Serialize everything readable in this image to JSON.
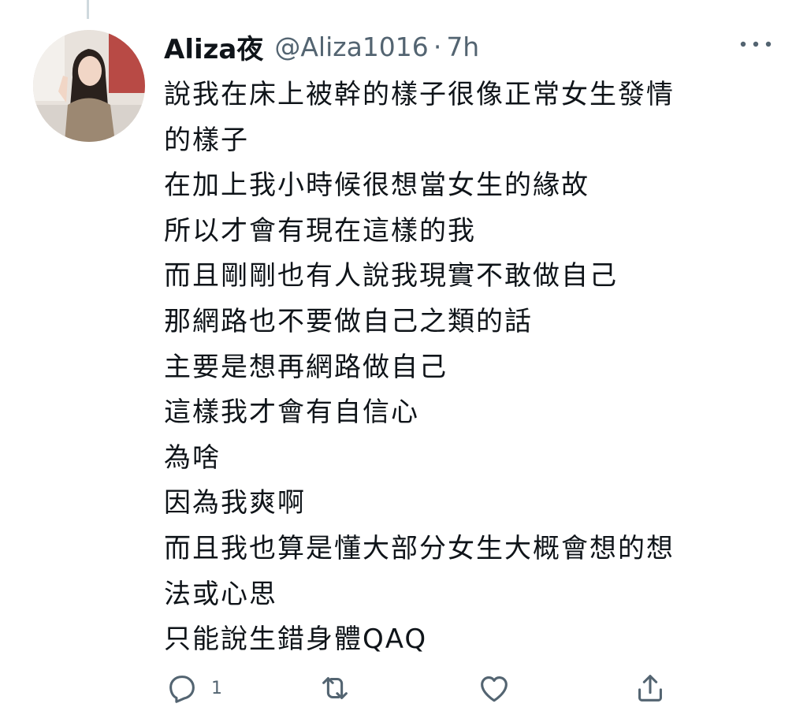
{
  "tweet": {
    "display_name": "Aliza夜",
    "handle": "@Aliza1016",
    "separator": "·",
    "timestamp": "7h",
    "body_lines": [
      "說我在床上被幹的樣子很像正常女生發情",
      "的樣子",
      "在加上我小時候很想當女生的緣故",
      "所以才會有現在這樣的我",
      "而且剛剛也有人說我現實不敢做自己",
      "那網路也不要做自己之類的話",
      "主要是想再網路做自己",
      "這樣我才會有自信心",
      "為啥",
      "因為我爽啊",
      "而且我也算是懂大部分女生大概會想的想",
      "法或心思",
      "只能說生錯身體QAQ"
    ],
    "actions": {
      "reply_count": "1",
      "reply_icon": "reply-icon",
      "retweet_icon": "retweet-icon",
      "like_icon": "heart-icon",
      "share_icon": "share-icon"
    },
    "more_icon": "more-icon"
  },
  "colors": {
    "text": "#0f1419",
    "secondary": "#536471",
    "icon": "#536471",
    "thread_line": "#cfd9de"
  }
}
